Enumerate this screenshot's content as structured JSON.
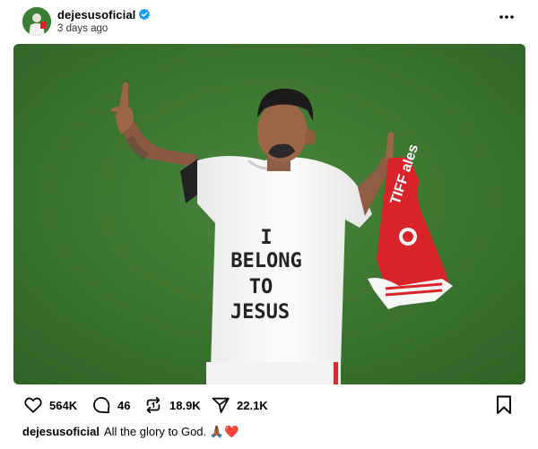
{
  "post": {
    "username": "dejesusoficial",
    "time_ago": "3 days ago",
    "verified": true
  },
  "media": {
    "shirt_text": [
      "I",
      "BELONG",
      "TO",
      "JESUS"
    ],
    "jersey_text": "TIFF ales"
  },
  "actions": {
    "likes": "564K",
    "comments": "46",
    "reposts": "18.9K",
    "shares": "22.1K"
  },
  "caption": {
    "username": "dejesusoficial",
    "text": "All the glory to God.",
    "emojis": "🙏🏾❤️"
  },
  "colors": {
    "verified": "#1d9bf0",
    "pitch": "#3f7a34",
    "jersey_red": "#d8232a"
  },
  "icons": [
    "verified-badge-icon",
    "more-icon",
    "heart-icon",
    "comment-icon",
    "repost-icon",
    "share-icon",
    "bookmark-icon"
  ]
}
